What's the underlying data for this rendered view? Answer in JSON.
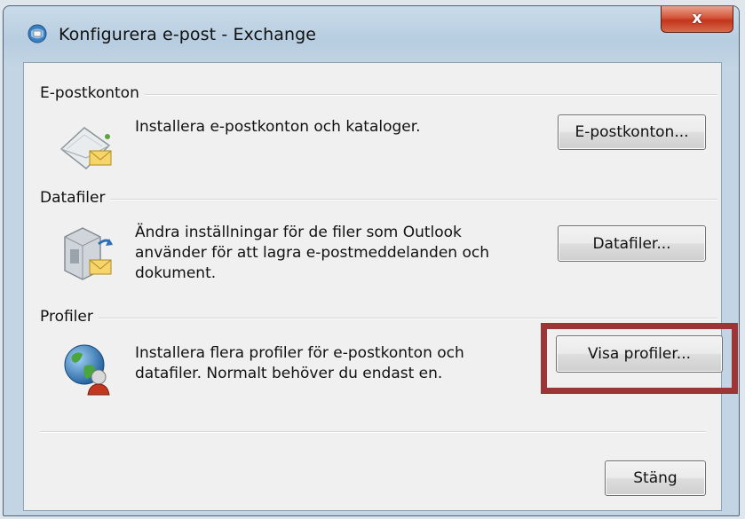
{
  "window": {
    "title": "Konfigurera e-post - Exchange",
    "close_label": "x"
  },
  "sections": [
    {
      "heading": "E-postkonton",
      "description": "Installera e-postkonton och kataloger.",
      "button_label": "E-postkonton...",
      "icon": "email-accounts-icon"
    },
    {
      "heading": "Datafiler",
      "description_lines": [
        "Ändra inställningar för de filer som Outlook",
        "använder för att lagra e-postmeddelanden och",
        "dokument."
      ],
      "button_label": "Datafiler...",
      "icon": "data-files-icon"
    },
    {
      "heading": "Profiler",
      "description_lines": [
        "Installera flera profiler för e-postkonton och",
        "datafiler. Normalt behöver du endast en."
      ],
      "button_label": "Visa profiler...",
      "icon": "profiles-globe-icon"
    }
  ],
  "footer": {
    "close_button_label": "Stäng"
  },
  "colors": {
    "highlight_border": "#9b3536",
    "close_button_red": "#c2341b"
  }
}
